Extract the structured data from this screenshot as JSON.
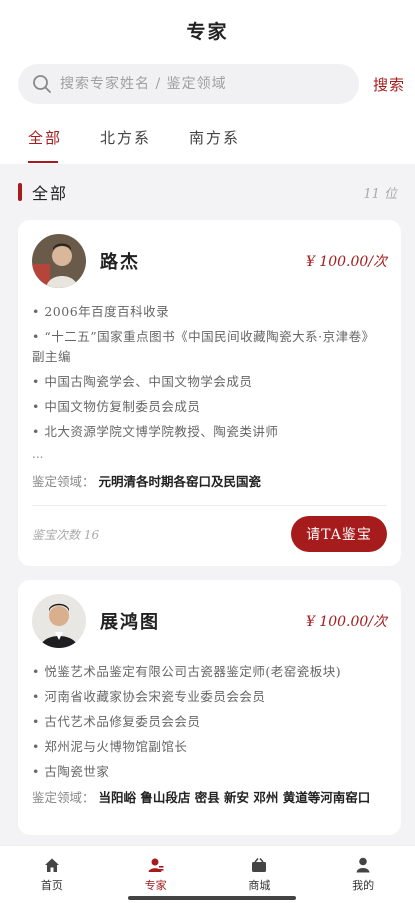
{
  "header": {
    "title": "专家"
  },
  "search": {
    "placeholder": "搜索专家姓名 / 鉴定领域",
    "button_label": "搜索"
  },
  "tabs": [
    {
      "label": "全部",
      "active": true
    },
    {
      "label": "北方系",
      "active": false
    },
    {
      "label": "南方系",
      "active": false
    }
  ],
  "section": {
    "label": "全部",
    "count": "11 位"
  },
  "experts": [
    {
      "name": "路杰",
      "price": "¥ 100.00/次",
      "bio": [
        "2006年百度百科收录",
        "“十二五”国家重点图书《中国民间收藏陶瓷大系·京津卷》副主编",
        "中国古陶瓷学会、中国文物学会成员",
        "中国文物仿复制委员会成员",
        "北大资源学院文博学院教授、陶瓷类讲师"
      ],
      "ellipsis": "...",
      "field_label": "鉴定领域：",
      "field_value": "元明清各时期各窑口及民国瓷",
      "times": "鉴宝次数 16",
      "button_label": "请TA鉴宝"
    },
    {
      "name": "展鸿图",
      "price": "¥ 100.00/次",
      "bio": [
        "悦鉴艺术品鉴定有限公司古瓷器鉴定师(老窑瓷板块)",
        "河南省收藏家协会宋瓷专业委员会会员",
        "古代艺术品修复委员会会员",
        "郑州泥与火博物馆副馆长",
        "古陶瓷世家"
      ],
      "field_label": "鉴定领域：",
      "field_value": "当阳峪 鲁山段店 密县 新安 邓州 黄道等河南窑口"
    }
  ],
  "tabbar": [
    {
      "label": "首页",
      "icon": "home-icon",
      "active": false
    },
    {
      "label": "专家",
      "icon": "expert-icon",
      "active": true
    },
    {
      "label": "商城",
      "icon": "shop-icon",
      "active": false
    },
    {
      "label": "我的",
      "icon": "profile-icon",
      "active": false
    }
  ],
  "colors": {
    "accent": "#a61b1b",
    "background": "#f3f3f5"
  }
}
